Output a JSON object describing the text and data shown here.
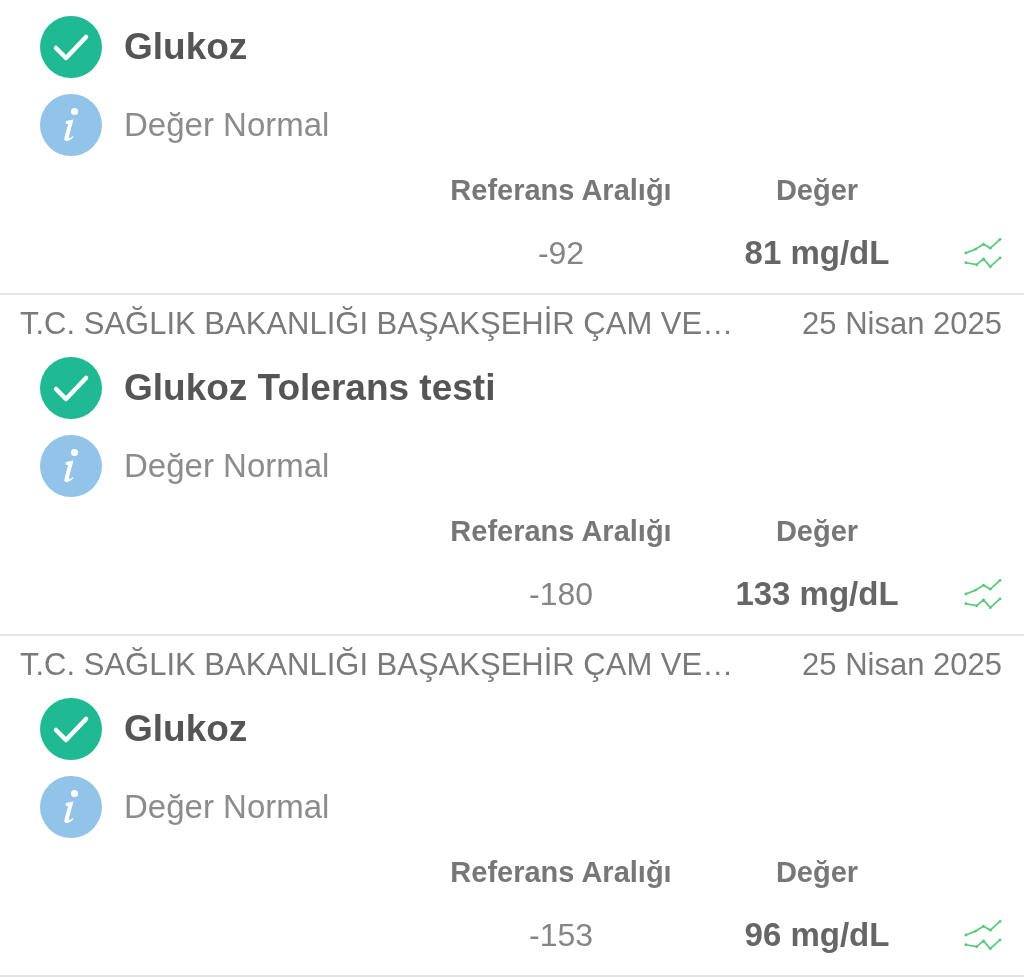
{
  "results": [
    {
      "test_name": "Glukoz",
      "note": "Değer Normal",
      "reference_label": "Referans Aralığı",
      "value_label": "Değer",
      "reference_range": "-92",
      "value": "81 mg/dL"
    },
    {
      "institution": "T.C. SAĞLIK BAKANLIĞI BAŞAKŞEHİR ÇAM VE…",
      "date": "25 Nisan 2025",
      "test_name": "Glukoz Tolerans testi",
      "note": "Değer Normal",
      "reference_label": "Referans Aralığı",
      "value_label": "Değer",
      "reference_range": "-180",
      "value": "133 mg/dL"
    },
    {
      "institution": "T.C. SAĞLIK BAKANLIĞI BAŞAKŞEHİR ÇAM VE…",
      "date": "25 Nisan 2025",
      "test_name": "Glukoz",
      "note": "Değer Normal",
      "reference_label": "Referans Aralığı",
      "value_label": "Değer",
      "reference_range": "-153",
      "value": "96 mg/dL"
    }
  ]
}
